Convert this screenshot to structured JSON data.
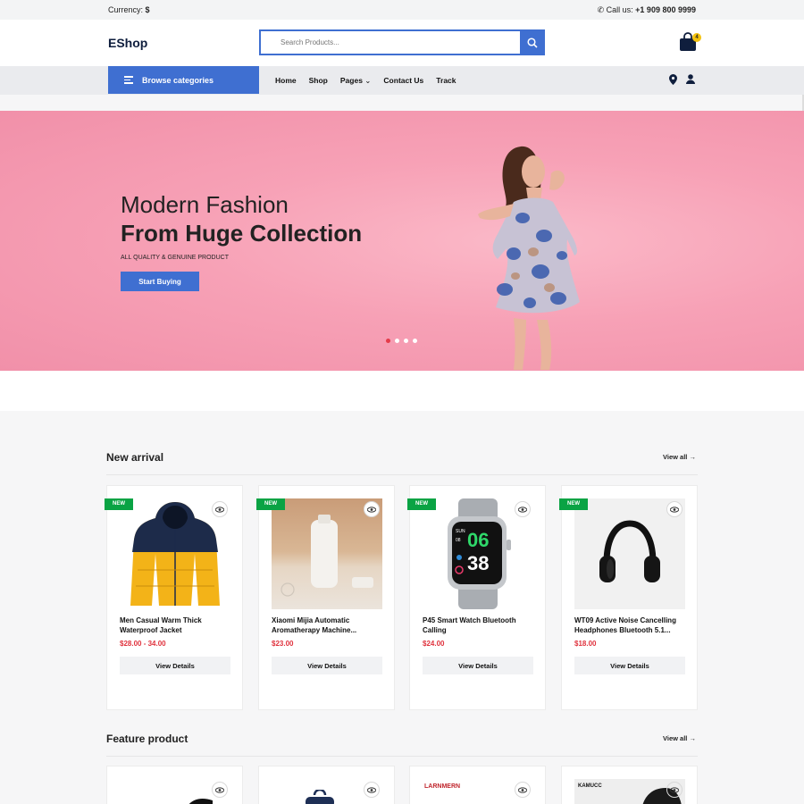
{
  "topbar": {
    "currency_label": "Currency:",
    "currency_value": "$",
    "call_label": "Call us:",
    "call_value": "+1 909 800 9999"
  },
  "header": {
    "logo": "EShop",
    "search_placeholder": "Search Products...",
    "cart_count": "4"
  },
  "nav": {
    "browse_label": "Browse categories",
    "links": [
      "Home",
      "Shop",
      "Pages",
      "Contact Us",
      "Track"
    ]
  },
  "hero": {
    "line1": "Modern Fashion",
    "line2": "From Huge Collection",
    "subtitle": "ALL QUALITY & GENUINE PRODUCT",
    "cta": "Start Buying",
    "slides": 4,
    "active_slide": 1
  },
  "new_arrival": {
    "title": "New arrival",
    "view_all": "View all →",
    "badge": "NEW",
    "button": "View Details",
    "products": [
      {
        "name": "Men Casual Warm Thick Waterproof Jacket",
        "price": "$28.00 - 34.00",
        "icon": "jacket-image"
      },
      {
        "name": "Xiaomi Mijia Automatic Aromatherapy Machine...",
        "price": "$23.00",
        "icon": "aroma-diffuser-image"
      },
      {
        "name": "P45 Smart Watch Bluetooth Calling",
        "price": "$24.00",
        "icon": "smartwatch-image"
      },
      {
        "name": "WT09 Active Noise Cancelling Headphones Bluetooth 5.1...",
        "price": "$18.00",
        "icon": "headphones-image"
      }
    ]
  },
  "feature_product": {
    "title": "Feature product",
    "view_all": "View all →",
    "brand1": "LARNMERN",
    "brand2": "KAMUCC"
  },
  "watch": {
    "h": "06",
    "m": "38"
  },
  "colors": {
    "accent": "#3f6fd1",
    "new_badge": "#0aa344",
    "price": "#e0333e",
    "hero_pink": "#f7a1b6"
  }
}
